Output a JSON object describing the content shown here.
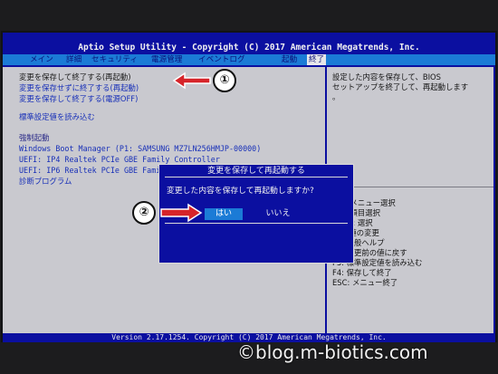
{
  "header": {
    "title": "Aptio Setup Utility - Copyright (C) 2017 American Megatrends, Inc."
  },
  "menu": {
    "tabs": [
      "メイン",
      "詳細",
      "セキュリティ",
      "電源管理",
      "イベントログ",
      "起動",
      "終了"
    ],
    "active": "終了"
  },
  "main": {
    "save_restart": "変更を保存して終了する(再起動)",
    "discard_restart": "変更を保存せずに終了する(再起動)",
    "save_poweroff": "変更を保存して終了する(電源OFF)",
    "load_defaults": "標準設定値を読み込む",
    "boot_override_heading": "強制起動",
    "boot_items": [
      "Windows Boot Manager (P1: SAMSUNG MZ7LN256HMJP-00000)",
      "UEFI: IP4 Realtek PCIe GBE Family Controller",
      "UEFI: IP6 Realtek PCIe GBE Family Controller"
    ],
    "diagnostics": "診断プログラム"
  },
  "help": {
    "description": [
      "設定した内容を保存して、BIOS",
      "セットアップを終了して、再起動します",
      "。"
    ],
    "keys": [
      "→←: メニュー選択",
      "↑↓: 項目選択",
      "Enter: 選択",
      "+/-: 値の変更",
      "F1: 一般ヘルプ",
      "F2: 変更前の値に戻す",
      "F3: 標準設定値を読み込む",
      "F4: 保存して終了",
      "ESC: メニュー終了"
    ]
  },
  "dialog": {
    "title": "変更を保存して再起動する",
    "message": "変更した内容を保存して再起動しますか?",
    "yes": "はい",
    "no": "いいえ"
  },
  "footer": {
    "version": "Version 2.17.1254. Copyright (C) 2017 American Megatrends, Inc."
  },
  "annotations": {
    "step1": "①",
    "step2": "②",
    "arrow_color": "#d6242a"
  },
  "watermark": "©blog.m-biotics.com"
}
